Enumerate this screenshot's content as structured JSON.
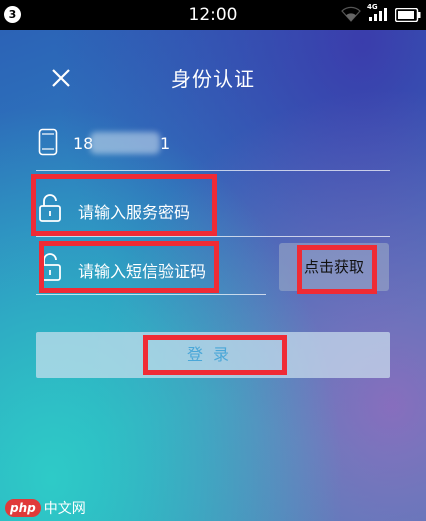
{
  "status_bar": {
    "notification_count": "3",
    "time": "12:00",
    "network_label": "4G",
    "icons": [
      "wifi-icon",
      "signal-icon",
      "battery-icon"
    ]
  },
  "header": {
    "title": "身份认证",
    "close_icon": "close-icon"
  },
  "form": {
    "phone": {
      "icon": "phone-icon",
      "prefix": "18",
      "suffix": "1"
    },
    "service_password": {
      "icon": "lock-icon",
      "placeholder": "请输入服务密码"
    },
    "sms_code": {
      "icon": "lock-icon",
      "placeholder": "请输入短信验证码"
    },
    "get_code_label": "点击获取",
    "login_label": "登录"
  },
  "watermark": {
    "logo_badge": "php",
    "logo_text": "中文网"
  },
  "colors": {
    "highlight": "#ef2b35",
    "title": "#ffffff",
    "login_text": "#4aa7d8"
  }
}
